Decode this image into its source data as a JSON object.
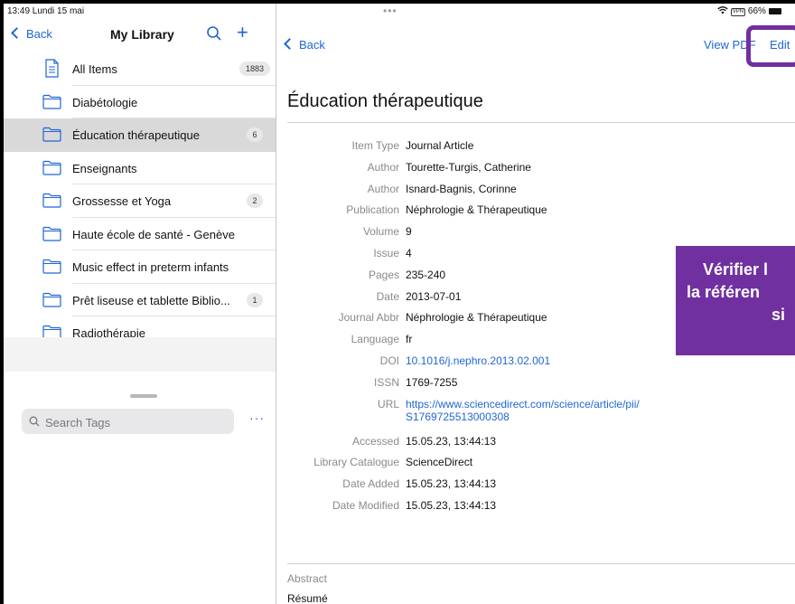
{
  "status_bar": {
    "time_date": "13:49  Lundi 15 mai",
    "dots": "•••",
    "vpn": "VPN",
    "battery": "66%"
  },
  "sidebar": {
    "back_label": "Back",
    "title": "My Library",
    "items": [
      {
        "label": "All Items",
        "count": "1883",
        "icon": "document-icon"
      },
      {
        "label": "Diabétologie",
        "count": "",
        "icon": "folder-icon"
      },
      {
        "label": "Éducation thérapeutique",
        "count": "6",
        "icon": "folder-icon",
        "selected": true
      },
      {
        "label": "Enseignants",
        "count": "",
        "icon": "folder-icon"
      },
      {
        "label": "Grossesse et Yoga",
        "count": "2",
        "icon": "folder-icon"
      },
      {
        "label": "Haute école de santé - Genève",
        "count": "",
        "icon": "folder-icon"
      },
      {
        "label": "Music effect in preterm infants",
        "count": "",
        "icon": "folder-icon"
      },
      {
        "label": "Prêt liseuse et tablette Biblio...",
        "count": "1",
        "icon": "folder-icon"
      },
      {
        "label": "Radiothérapie",
        "count": "",
        "icon": "folder-icon"
      }
    ],
    "tags_search": {
      "placeholder": "Search Tags"
    },
    "more_label": "···"
  },
  "detail": {
    "back_label": "Back",
    "view_pdf_label": "View PDF",
    "edit_label": "Edit",
    "title": "Éducation thérapeutique",
    "fields": [
      {
        "key": "Item Type",
        "value": "Journal Article"
      },
      {
        "key": "Author",
        "value": "Tourette-Turgis, Catherine"
      },
      {
        "key": "Author",
        "value": "Isnard-Bagnis, Corinne"
      },
      {
        "key": "Publication",
        "value": "Néphrologie & Thérapeutique"
      },
      {
        "key": "Volume",
        "value": "9"
      },
      {
        "key": "Issue",
        "value": "4"
      },
      {
        "key": "Pages",
        "value": "235-240"
      },
      {
        "key": "Date",
        "value": "2013-07-01"
      },
      {
        "key": "Journal Abbr",
        "value": "Néphrologie & Thérapeutique"
      },
      {
        "key": "Language",
        "value": "fr"
      },
      {
        "key": "DOI",
        "value": "10.1016/j.nephro.2013.02.001"
      },
      {
        "key": "ISSN",
        "value": "1769-7255"
      },
      {
        "key": "URL",
        "value": "https://www.sciencedirect.com/science/article/pii/",
        "value2": "S1769725513000308"
      },
      {
        "key": "Accessed",
        "value": "15.05.23, 13:44:13"
      },
      {
        "key": "Library Catalogue",
        "value": "ScienceDirect"
      },
      {
        "key": "Date Added",
        "value": "15.05.23, 13:44:13"
      },
      {
        "key": "Date Modified",
        "value": "15.05.23, 13:44:13"
      }
    ],
    "abstract_label": "Abstract",
    "abstract_text": "Résumé"
  },
  "callout": {
    "line1": "Vérifier l",
    "line2": "la référen",
    "line3": "si"
  },
  "colors": {
    "accent": "#1f66d6",
    "callout": "#7030a0",
    "selected_row": "#d9d9d9"
  }
}
